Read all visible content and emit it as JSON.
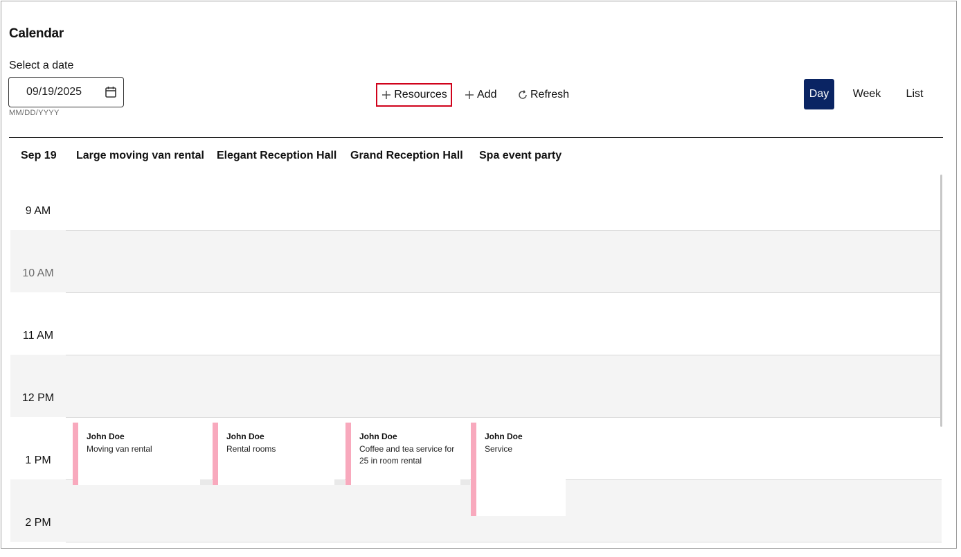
{
  "page": {
    "title": "Calendar",
    "date_label": "Select a date",
    "date_value": "09/19/2025",
    "date_hint": "MM/DD/YYYY"
  },
  "toolbar": {
    "resources_label": "Resources",
    "add_label": "Add",
    "refresh_label": "Refresh"
  },
  "views": {
    "day": "Day",
    "week": "Week",
    "list": "List",
    "active": "Day",
    "active_color": "#0a2463"
  },
  "columns": {
    "date": "Sep 19",
    "resources": [
      "Large moving van rental",
      "Elegant Reception Hall",
      "Grand Reception Hall",
      "Spa event party"
    ]
  },
  "hours": [
    "9 AM",
    "10 AM",
    "11 AM",
    "12 PM",
    "1 PM",
    "2 PM"
  ],
  "events": [
    {
      "who": "John Doe",
      "desc": "Moving van rental"
    },
    {
      "who": "John Doe",
      "desc": "Rental rooms"
    },
    {
      "who": "John Doe",
      "desc": "Coffee and tea service for 25 in room rental"
    },
    {
      "who": "John Doe",
      "desc": "Service"
    }
  ],
  "colors": {
    "highlight_border": "#d0021b",
    "event_bar": "#f8a9bd"
  }
}
